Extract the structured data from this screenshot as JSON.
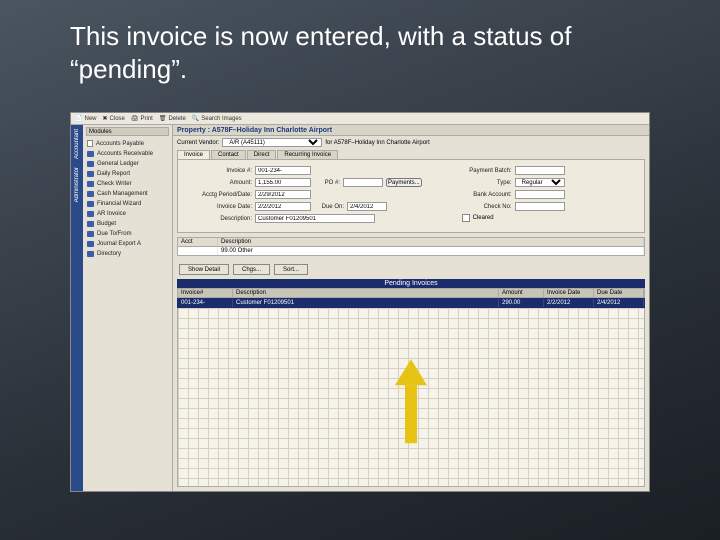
{
  "slide_title": "This invoice is now entered, with a status of “pending”.",
  "toolbar": {
    "new": "New",
    "close": "Close",
    "print": "Print",
    "delete": "Delete",
    "search_images": "Search Images"
  },
  "side_tabs": {
    "a": "Accountant",
    "b": "Administrator"
  },
  "nav": {
    "title": "Modules",
    "items": [
      "Accounts Payable",
      "Accounts Receivable",
      "General Ledger",
      "Daily Report",
      "Check Writer",
      "Cash Management",
      "Financial Wizard",
      "AR Invoice",
      "Budget",
      "Due To/From",
      "Journal Export A",
      "Directory"
    ]
  },
  "property_bar": "Property : A578F–Holiday Inn Charlotte Airport",
  "vendor": {
    "label": "Current Vendor:",
    "value": "A/R (A45111)",
    "for_label": "for A578F–Holiday Inn Charlotte Airport"
  },
  "tabs": [
    "Invoice",
    "Contact",
    "Direct",
    "Recurring Invoice"
  ],
  "form": {
    "invoice_no_label": "Invoice #:",
    "invoice_no": "001-234-",
    "amount_label": "Amount:",
    "amount": "1,155.00",
    "posting_label": "Acctg Period/Date:",
    "posting": "2/29/2012",
    "invoice_date_label": "Invoice Date:",
    "invoice_date": "2/2/2012",
    "desc_label": "Description:",
    "desc": "Customer F01209501",
    "po_label": "PO #:",
    "po_btn": "Payments...",
    "due_label": "Due On:",
    "due": "2/4/2012",
    "payment_batch_label": "Payment Batch:",
    "type_label": "Type:",
    "type": "Regular",
    "bank_label": "Bank Account:",
    "check_label": "Check No:",
    "cleared_label": "Cleared"
  },
  "mini": {
    "h1": "Acct",
    "h2": "Description",
    "v1": "",
    "v2": "99.00 Other"
  },
  "btns": {
    "show": "Show Detail",
    "chg": "Chgs...",
    "sort": "Sort..."
  },
  "pending_bar": "Pending Invoices",
  "gridhead": {
    "c1": "Invoice#",
    "c2": "Description",
    "c3": "Amount",
    "c4": "Invoice Date",
    "c5": "Due Date"
  },
  "gridrow": {
    "c1": "001-234-",
    "c2": "Customer F01209501",
    "c3": "290.00",
    "c4": "2/2/2012",
    "c5": "2/4/2012"
  }
}
